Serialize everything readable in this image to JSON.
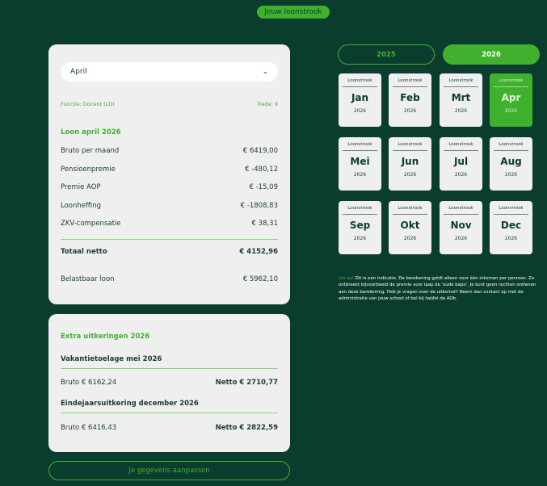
{
  "header": {
    "badge": "Jouw loonstrook"
  },
  "main": {
    "select_value": "April",
    "function_label": "Functie: Docent (LD)",
    "scale_label": "Trede: 9",
    "section_title": "Loon april 2026",
    "rows": [
      {
        "label": "Bruto per maand",
        "value": "€ 6419,00"
      },
      {
        "label": "Pensioenpremie",
        "value": "€ -480,12"
      },
      {
        "label": "Premie AOP",
        "value": "€ -15,09"
      },
      {
        "label": "Loonheffing",
        "value": "€ -1808,83"
      },
      {
        "label": "ZKV-compensatie",
        "value": "€ 38,31"
      }
    ],
    "total_label": "Totaal netto",
    "total_value": "€ 4152,96",
    "taxable_label": "Belastbaar loon",
    "taxable_value": "€ 5962,10"
  },
  "extra": {
    "title": "Extra uitkeringen 2026",
    "items": [
      {
        "title": "Vakantietoelage mei 2026",
        "gross": "Bruto € 6162,24",
        "net": "Netto € 2710,77"
      },
      {
        "title": "Eindejaarsuitkering december 2026",
        "gross": "Bruto € 6416,43",
        "net": "Netto € 2822,59"
      }
    ]
  },
  "edit_button": "Je gegevens aanpassen",
  "years": [
    "2025",
    "2026"
  ],
  "months": [
    {
      "label": "Loonstrook",
      "name": "Jan",
      "year": "2026"
    },
    {
      "label": "Loonstrook",
      "name": "Feb",
      "year": "2026"
    },
    {
      "label": "Loonstrook",
      "name": "Mrt",
      "year": "2026"
    },
    {
      "label": "Loonstrook",
      "name": "Apr",
      "year": "2026"
    },
    {
      "label": "Loonstrook",
      "name": "Mei",
      "year": "2026"
    },
    {
      "label": "Loonstrook",
      "name": "Jun",
      "year": "2026"
    },
    {
      "label": "Loonstrook",
      "name": "Jul",
      "year": "2026"
    },
    {
      "label": "Loonstrook",
      "name": "Aug",
      "year": "2026"
    },
    {
      "label": "Loonstrook",
      "name": "Sep",
      "year": "2026"
    },
    {
      "label": "Loonstrook",
      "name": "Okt",
      "year": "2026"
    },
    {
      "label": "Loonstrook",
      "name": "Nov",
      "year": "2026"
    },
    {
      "label": "Loonstrook",
      "name": "Dec",
      "year": "2026"
    }
  ],
  "note": {
    "highlight": "Let op!",
    "text": " Dit is een indicatie. De berekening geldt alleen voor één inkomen per persoon. Zo ontbreekt bijvoorbeeld de premie voor ipap de 'oude bapo'. Je kunt geen rechten ontlenen aan deze berekening. Heb je vragen over de uitkomst? Neem dan contact op met de administratie van jouw school of bel bij twijfel de AOb."
  },
  "colors": {
    "background": "#0b3d2e",
    "accent": "#3fb12f",
    "card": "#efefef"
  }
}
